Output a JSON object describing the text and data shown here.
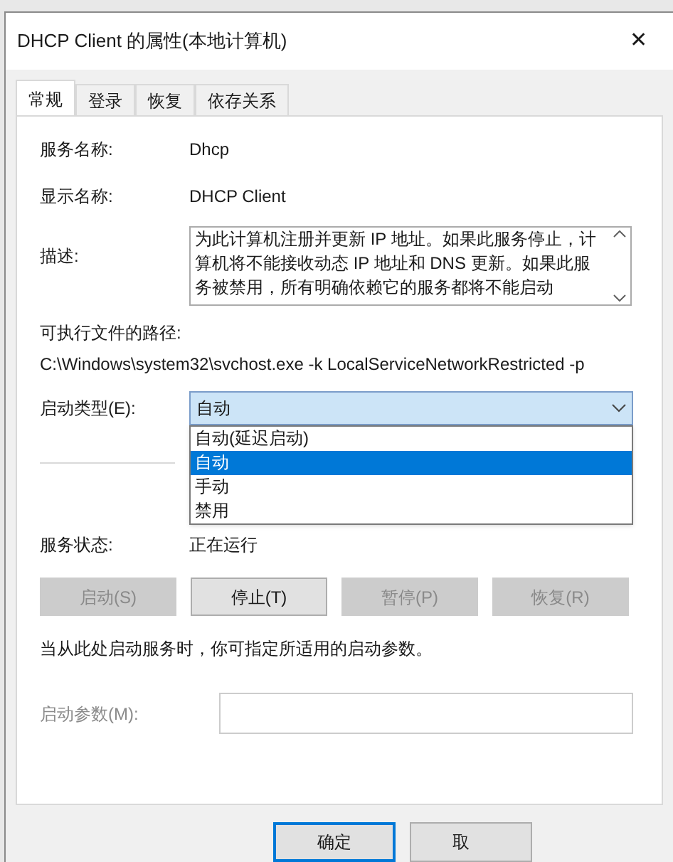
{
  "window": {
    "title": "DHCP Client 的属性(本地计算机)",
    "close": "✕"
  },
  "tabs": [
    {
      "label": "常规",
      "selected": true
    },
    {
      "label": "登录",
      "selected": false
    },
    {
      "label": "恢复",
      "selected": false
    },
    {
      "label": "依存关系",
      "selected": false
    }
  ],
  "service_name": {
    "label": "服务名称:",
    "value": "Dhcp"
  },
  "display_name": {
    "label": "显示名称:",
    "value": "DHCP Client"
  },
  "description": {
    "label": "描述:",
    "text": "为此计算机注册并更新 IP 地址。如果此服务停止，计算机将不能接收动态 IP 地址和 DNS 更新。如果此服务被禁用，所有明确依赖它的服务都将不能启动"
  },
  "path": {
    "label": "可执行文件的路径:",
    "value": "C:\\Windows\\system32\\svchost.exe -k LocalServiceNetworkRestricted -p"
  },
  "startup_type": {
    "label": "启动类型(E):",
    "value": "自动",
    "expanded": true,
    "options": [
      {
        "label": "自动(延迟启动)",
        "selected": false
      },
      {
        "label": "自动",
        "selected": true
      },
      {
        "label": "手动",
        "selected": false
      },
      {
        "label": "禁用",
        "selected": false
      }
    ]
  },
  "service_status": {
    "label": "服务状态:",
    "value": "正在运行"
  },
  "service_buttons": [
    {
      "label": "启动(S)",
      "disabled": true
    },
    {
      "label": "停止(T)",
      "disabled": false
    },
    {
      "label": "暂停(P)",
      "disabled": true
    },
    {
      "label": "恢复(R)",
      "disabled": true
    }
  ],
  "hint": "当从此处启动服务时，你可指定所适用的启动参数。",
  "start_params": {
    "label": "启动参数(M):",
    "disabled": true
  },
  "footer_buttons": [
    {
      "label": "确定",
      "default": true
    },
    {
      "label": "取",
      "default": false
    }
  ]
}
